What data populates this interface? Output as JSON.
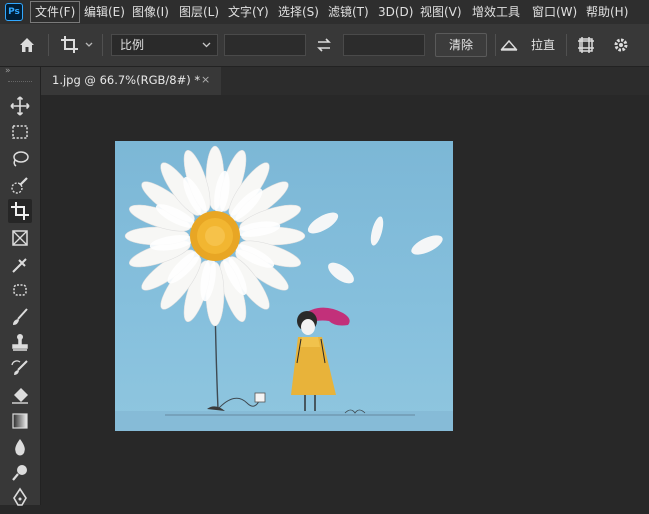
{
  "app": {
    "logo": "Ps"
  },
  "menu": [
    {
      "label": "文件(F)",
      "active": true
    },
    {
      "label": "编辑(E)"
    },
    {
      "label": "图像(I)"
    },
    {
      "label": "图层(L)"
    },
    {
      "label": "文字(Y)"
    },
    {
      "label": "选择(S)"
    },
    {
      "label": "滤镜(T)"
    },
    {
      "label": "3D(D)"
    },
    {
      "label": "视图(V)"
    },
    {
      "label": "增效工具"
    },
    {
      "label": "窗口(W)"
    },
    {
      "label": "帮助(H)"
    }
  ],
  "options": {
    "ratio_select": "比例",
    "width_value": "",
    "height_value": "",
    "clear_button": "清除",
    "straighten_label": "拉直"
  },
  "document": {
    "tab_title": "1.jpg @ 66.7%(RGB/8#) *",
    "close": "×"
  },
  "tools": [
    "move-tool",
    "marquee-tool",
    "lasso-tool",
    "quick-select-tool",
    "crop-tool",
    "frame-tool",
    "eyedropper-tool",
    "healing-brush-tool",
    "brush-tool",
    "clone-stamp-tool",
    "history-brush-tool",
    "eraser-tool",
    "gradient-tool",
    "blur-tool",
    "dodge-tool",
    "pen-tool"
  ],
  "colors": {
    "accent": "#31a8ff",
    "panel": "#383838",
    "canvas_bg": "#282828"
  }
}
